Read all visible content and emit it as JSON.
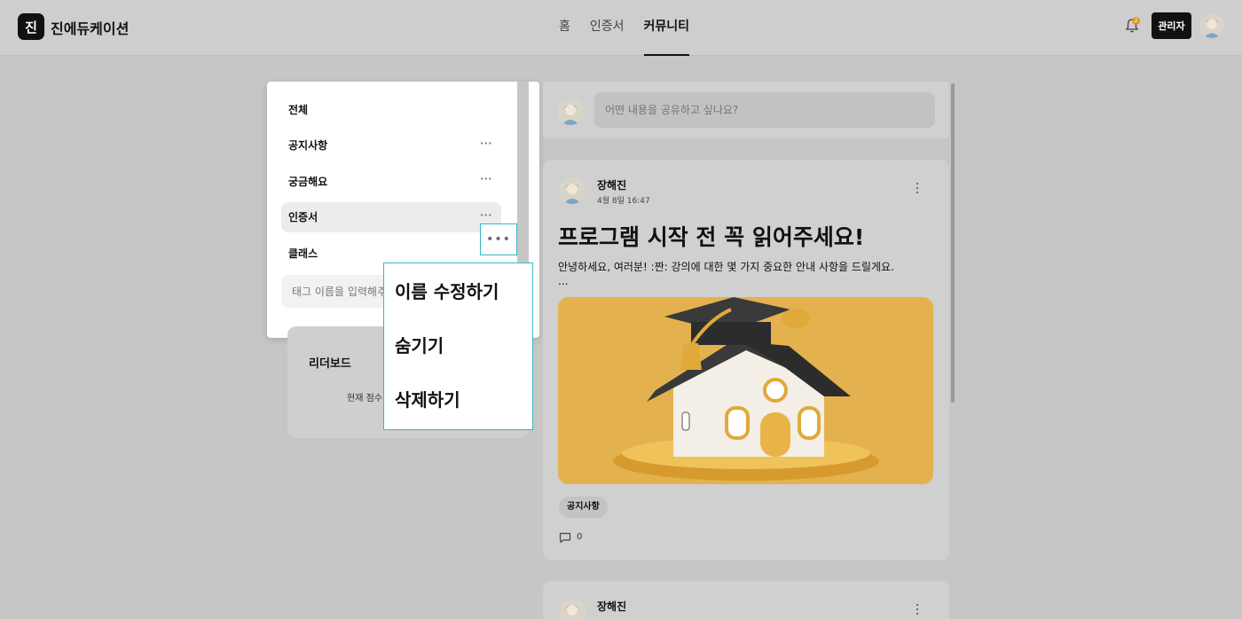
{
  "header": {
    "logo_letter": "진",
    "brand": "진에듀케이션",
    "nav": [
      "홈",
      "인증서",
      "커뮤니티"
    ],
    "active_nav": "커뮤니티",
    "notification_count": "2",
    "admin_label": "관리자"
  },
  "sidebar": {
    "items": [
      {
        "label": "전체",
        "has_menu": false
      },
      {
        "label": "공지사항",
        "has_menu": true
      },
      {
        "label": "궁금해요",
        "has_menu": true
      },
      {
        "label": "인증서",
        "has_menu": true,
        "selected": true
      },
      {
        "label": "클래스",
        "has_menu": true
      }
    ],
    "tag_placeholder": "태그 이름을 입력해주세요",
    "menu_dots": "•••",
    "context_menu": [
      "이름 수정하기",
      "숨기기",
      "삭제하기"
    ]
  },
  "leaderboard": {
    "title": "리더보드",
    "subtitle": "현재 점수"
  },
  "composer": {
    "placeholder": "어떤 내용을 공유하고 싶나요?"
  },
  "posts": [
    {
      "author": "장해진",
      "date": "4월 8일 16:47",
      "title": "프로그램 시작 전 꼭 읽어주세요!",
      "body": "안녕하세요, 여러분! :짠: 강의에 대한 몇 가지 중요한 안내 사항을 드릴게요.",
      "ellipsis": "...",
      "tag": "공지사항",
      "comments": "0",
      "image_icon": "graduation-house-illustration"
    },
    {
      "author": "장해진"
    }
  ],
  "colors": {
    "accent_outline": "#3bb6c2",
    "dark": "#111111",
    "image_bg": "#e3b24f",
    "badge": "#e0962a"
  }
}
